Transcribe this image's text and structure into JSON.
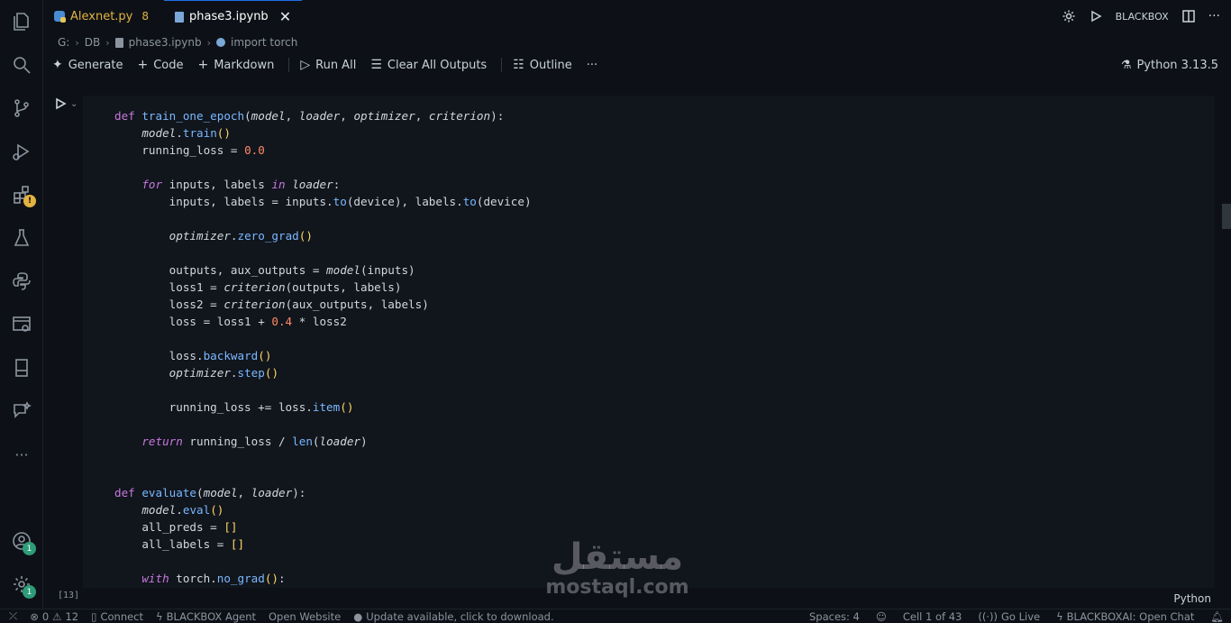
{
  "tabs": [
    {
      "label": "Alexnet.py",
      "count": "8"
    },
    {
      "label": "phase3.ipynb",
      "close": "✕"
    }
  ],
  "topbar": {
    "blackbox_label": "BLACKBOX"
  },
  "breadcrumb": {
    "items": [
      "G:",
      "DB",
      "phase3.ipynb",
      "import torch"
    ]
  },
  "toolbar": {
    "generate": "Generate",
    "code": "Code",
    "markdown": "Markdown",
    "run_all": "Run All",
    "clear_outputs": "Clear All Outputs",
    "outline": "Outline",
    "more": "···",
    "kernel": "Python 3.13.5"
  },
  "cell": {
    "exec_count": "[13]",
    "language": "Python"
  },
  "activity_badges": {
    "accounts": "1",
    "manage": "1"
  },
  "watermark": {
    "arabic": "مستقل",
    "latin": "mostaql.com"
  },
  "status": {
    "errors": "0",
    "warnings": "12",
    "connect": "Connect",
    "agent": "BLACKBOX Agent",
    "open_website": "Open Website",
    "update": "Update available, click to download.",
    "spaces": "Spaces: 4",
    "cell_pos": "Cell 1 of 43",
    "go_live": "Go Live",
    "open_chat": "BLACKBOXAI: Open Chat"
  },
  "colors": {
    "accent": "#1f6feb",
    "keyword": "#c678dd",
    "function": "#79b8ff",
    "number": "#ff8a65",
    "bracket": "#ffd866",
    "warning": "#e3b341"
  }
}
